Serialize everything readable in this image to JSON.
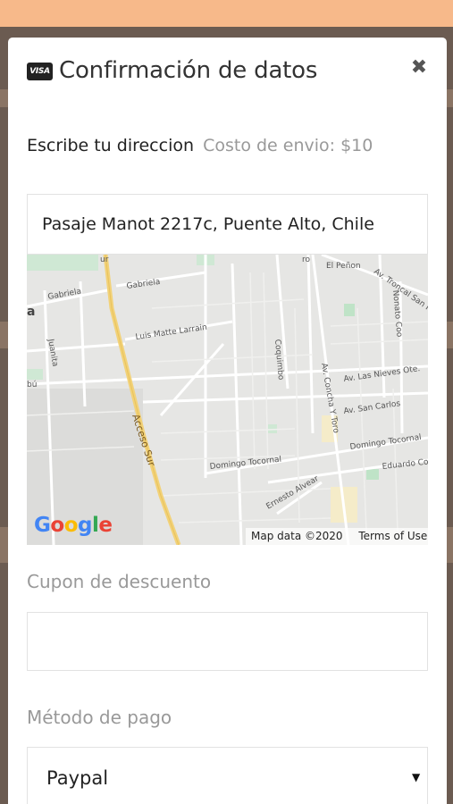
{
  "modal": {
    "visa_badge": "VISA",
    "title": "Confirmación de datos",
    "close_glyph": "✖"
  },
  "address": {
    "label": "Escribe tu direccion",
    "shipping_cost": "Costo de envio: $10",
    "value": "Pasaje Manot 2217c, Puente Alto, Chile"
  },
  "map": {
    "streets": [
      "Gabriela",
      "Gabriela",
      "Luis Matte Larrain",
      "Acceso Sur",
      "Juanita",
      "Coquimbo",
      "El Peñon",
      "Av. Troncal San Fr",
      "Nonato Coo",
      "Av. Las Nieves Ote.",
      "Av. San Carlos",
      "Av. Concha Y Toro",
      "Domingo Tocornal",
      "Domingo Tocornal",
      "Eduardo Co",
      "Ernesto Alvear",
      "ur",
      "a",
      "bú",
      "ro"
    ],
    "logo": "Google",
    "attribution": "Map data ©2020",
    "terms": "Terms of Use"
  },
  "coupon": {
    "label": "Cupon de descuento",
    "value": ""
  },
  "payment": {
    "label": "Método de pago",
    "selected": "Paypal",
    "arrow": "▼"
  }
}
